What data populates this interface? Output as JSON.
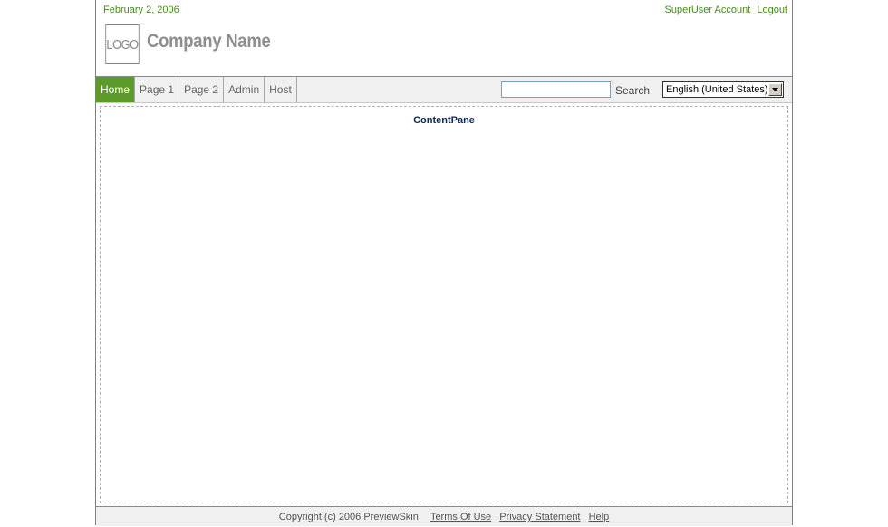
{
  "header": {
    "date": "February 2, 2006",
    "user": "SuperUser Account",
    "logout": "Logout",
    "logo_text": "LOGO",
    "company_name": "Company Name"
  },
  "nav": {
    "tabs": [
      {
        "label": "Home",
        "active": true
      },
      {
        "label": "Page 1",
        "active": false
      },
      {
        "label": "Page 2",
        "active": false
      },
      {
        "label": "Admin",
        "active": false
      },
      {
        "label": "Host",
        "active": false
      }
    ],
    "search_value": "",
    "search_label": "Search",
    "language": "English (United States)"
  },
  "content": {
    "pane_title": "ContentPane"
  },
  "footer": {
    "copyright": "Copyright (c) 2006 PreviewSkin",
    "terms": "Terms Of Use",
    "privacy": "Privacy Statement",
    "help": "Help"
  },
  "colors": {
    "accent_green": "#5c9a2a",
    "link_green": "#4a8a1a",
    "pane_title": "#0b2a55"
  }
}
